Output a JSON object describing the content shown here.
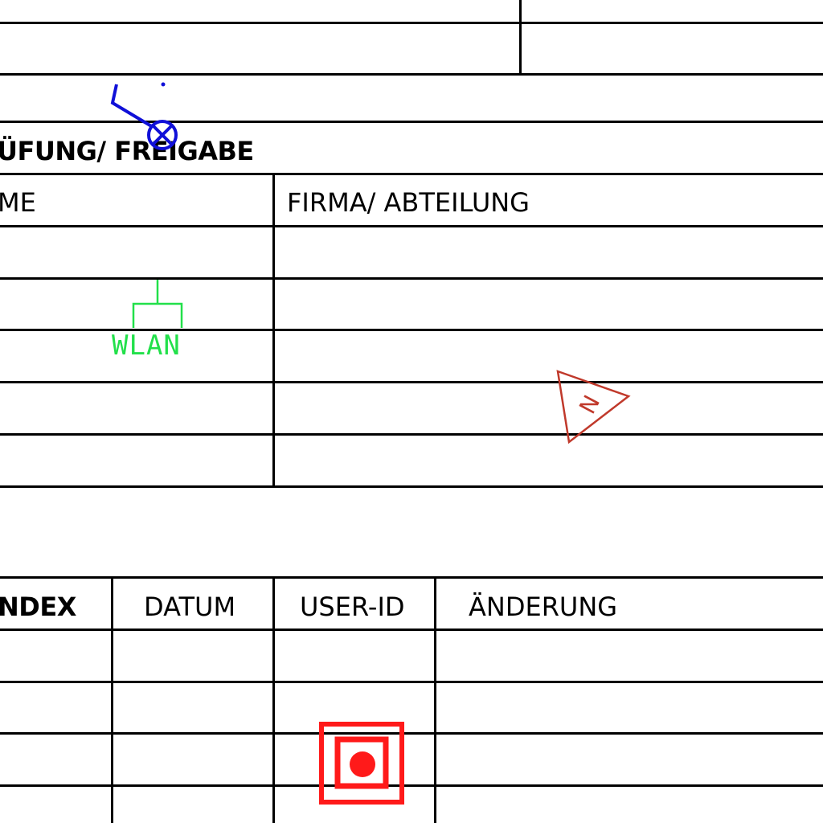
{
  "approval_section": {
    "title": "ÜFUNG/ FREIGABE",
    "columns": {
      "name": "ME",
      "company": "FIRMA/ ABTEILUNG"
    }
  },
  "revision_table": {
    "columns": {
      "index": "NDEX",
      "date": "DATUM",
      "user_id": "USER-ID",
      "change": "ÄNDERUNG"
    }
  },
  "symbols": {
    "wlan": {
      "label": "WLAN",
      "color": "#22e04a",
      "icon": "wlan-access-point-icon"
    },
    "lamp": {
      "color": "#1010d8",
      "icon": "ceiling-lamp-icon"
    },
    "triangle": {
      "label": "N",
      "color": "#c0392b",
      "icon": "n-triangle-icon"
    },
    "outlet": {
      "color": "#ff1a1a",
      "icon": "floor-outlet-icon"
    }
  }
}
